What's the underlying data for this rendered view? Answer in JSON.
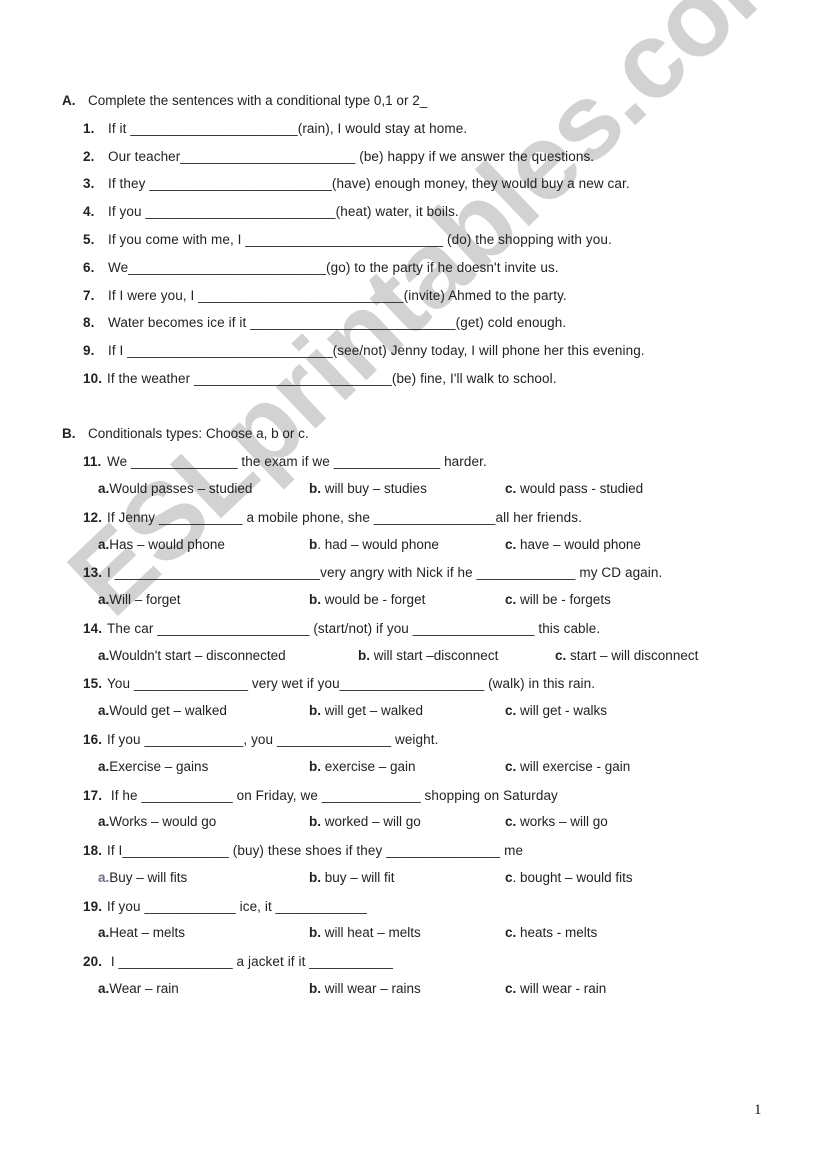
{
  "watermark": "ESLprintables.com",
  "section_a": {
    "letter": "A.",
    "instruction": "Complete the sentences with a conditional type 0,1 or 2_",
    "items": [
      {
        "num": "1.",
        "text": "If it ______________________(rain), I would stay at home."
      },
      {
        "num": "2.",
        "text": "Our teacher_______________________ (be) happy if we answer the questions."
      },
      {
        "num": "3.",
        "text": "If they ________________________(have) enough money, they would buy a new car."
      },
      {
        "num": "4.",
        "text": "If you _________________________(heat) water, it boils."
      },
      {
        "num": "5.",
        "text": "If you come with me, I __________________________ (do) the shopping with you."
      },
      {
        "num": "6.",
        "text": "We__________________________(go) to the party if he doesn't invite us."
      },
      {
        "num": "7.",
        "text": "If I were you, I ___________________________(invite) Ahmed to the party."
      },
      {
        "num": "8.",
        "text": "Water becomes ice if it ___________________________(get) cold enough."
      },
      {
        "num": "9.",
        "text": "If I ___________________________(see/not) Jenny today, I will phone her this evening."
      },
      {
        "num": "10.",
        "text": "If the weather __________________________(be) fine, I'll walk to school."
      }
    ]
  },
  "section_b": {
    "letter": "B.",
    "instruction": "Conditionals types: Choose a, b or c.",
    "items": [
      {
        "num": "11.",
        "text": "We ______________ the exam if we ______________ harder.",
        "options": [
          {
            "label": "a.",
            "text": "Would passes – studied"
          },
          {
            "label": "b.",
            "text": "will buy – studies"
          },
          {
            "label": "c.",
            "text": "would pass - studied"
          }
        ]
      },
      {
        "num": "12.",
        "text": "If Jenny ___________ a mobile phone, she ________________all her friends.",
        "options": [
          {
            "label": "a.",
            "text": "Has – would phone"
          },
          {
            "label": "b",
            "text": ". had – would phone"
          },
          {
            "label": "c.",
            "text": "have – would phone"
          }
        ]
      },
      {
        "num": "13.",
        "text": "I ___________________________very angry with Nick if he _____________ my CD again.",
        "options": [
          {
            "label": "a.",
            "text": "Will – forget"
          },
          {
            "label": "b.",
            "text": "would be - forget"
          },
          {
            "label": "c.",
            "text": "will be - forgets"
          }
        ]
      },
      {
        "num": "14.",
        "text": "The car ____________________ (start/not) if you ________________ this cable.",
        "options": [
          {
            "label": "a.",
            "text": "Wouldn't start – disconnected"
          },
          {
            "label": "b.",
            "text": "will start –disconnect"
          },
          {
            "label": "c.",
            "text": "start – will disconnect"
          }
        ]
      },
      {
        "num": "15.",
        "text": "You _______________ very wet if you___________________ (walk) in this rain.",
        "options": [
          {
            "label": "a.",
            "text": "Would get – walked"
          },
          {
            "label": "b.",
            "text": "will get – walked"
          },
          {
            "label": "c.",
            "text": "will get - walks"
          }
        ]
      },
      {
        "num": "16.",
        "text": "If you _____________, you _______________ weight.",
        "options": [
          {
            "label": "a.",
            "text": "Exercise – gains"
          },
          {
            "label": "b.",
            "text": "exercise – gain"
          },
          {
            "label": "c.",
            "text": "will exercise - gain"
          }
        ]
      },
      {
        "num": "17.",
        "text": " If he ____________ on Friday, we _____________ shopping on Saturday",
        "options": [
          {
            "label": "a.",
            "text": "Works – would go"
          },
          {
            "label": "b.",
            "text": "worked – will go"
          },
          {
            "label": "c.",
            "text": "works – will go"
          }
        ]
      },
      {
        "num": "18.",
        "text": "If I______________ (buy)  these shoes if they _______________ me",
        "options": [
          {
            "label": "a.",
            "text": "Buy – will fits"
          },
          {
            "label": "b.",
            "text": "buy – will fit"
          },
          {
            "label": "c",
            "text": ". bought – would fits"
          }
        ]
      },
      {
        "num": "19.",
        "text": "If you ____________ ice, it ____________",
        "options": [
          {
            "label": "a.",
            "text": "Heat – melts"
          },
          {
            "label": "b.",
            "text": "will heat – melts"
          },
          {
            "label": "c.",
            "text": "heats - melts"
          }
        ]
      },
      {
        "num": "20.",
        "text": " I _______________ a jacket if it ___________",
        "options": [
          {
            "label": "a.",
            "text": "Wear – rain"
          },
          {
            "label": "b.",
            "text": "will wear – rains"
          },
          {
            "label": "c.",
            "text": "will wear - rain"
          }
        ]
      }
    ]
  },
  "page_number": "1"
}
